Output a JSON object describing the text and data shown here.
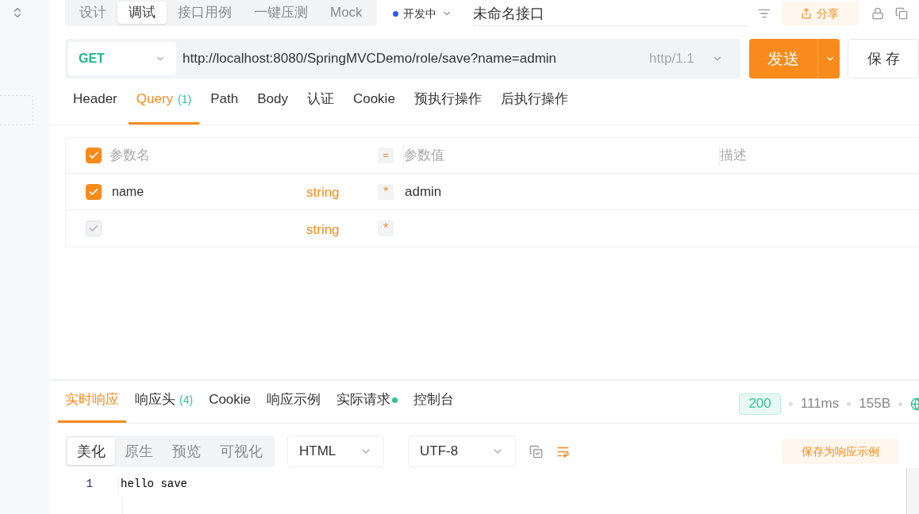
{
  "mode_tabs": [
    {
      "label": "设计",
      "selected": false
    },
    {
      "label": "调试",
      "selected": true
    },
    {
      "label": "接口用例",
      "selected": false
    },
    {
      "label": "一键压测",
      "selected": false
    },
    {
      "label": "Mock",
      "selected": false
    }
  ],
  "status": "开发中",
  "api_name": "未命名接口",
  "share_button": "分享",
  "request": {
    "method": "GET",
    "url": "http://localhost:8080/SpringMVCDemo/role/save?name=admin",
    "protocol": "http/1.1",
    "send_button": "发送",
    "save_button": "保 存"
  },
  "request_tabs": [
    {
      "label": "Header",
      "selected": false
    },
    {
      "label": "Query",
      "count": "(1)",
      "selected": true
    },
    {
      "label": "Path",
      "selected": false
    },
    {
      "label": "Body",
      "selected": false
    },
    {
      "label": "认证",
      "selected": false
    },
    {
      "label": "Cookie",
      "selected": false
    },
    {
      "label": "预执行操作",
      "selected": false
    },
    {
      "label": "后执行操作",
      "selected": false
    }
  ],
  "params": {
    "header": {
      "checked": true,
      "name": "参数名",
      "equals": "=",
      "value": "参数值",
      "description": "描述"
    },
    "rows": [
      {
        "checked": true,
        "disabled": false,
        "name": "name",
        "type": "string",
        "required": "*",
        "value": "admin"
      },
      {
        "checked": true,
        "disabled": true,
        "type": "string",
        "required": "*"
      }
    ]
  },
  "response_tabs": [
    {
      "label": "实时响应",
      "selected": true
    },
    {
      "label": "响应头",
      "count": "(4)",
      "selected": false
    },
    {
      "label": "Cookie",
      "selected": false
    },
    {
      "label": "响应示例",
      "selected": false
    },
    {
      "label": "实际请求",
      "indicator": true,
      "selected": false
    },
    {
      "label": "控制台",
      "selected": false
    }
  ],
  "response_meta": {
    "status_code": "200",
    "time": "111ms",
    "size": "155B"
  },
  "view_tabs": [
    {
      "label": "美化",
      "selected": true
    },
    {
      "label": "原生",
      "selected": false
    },
    {
      "label": "预览",
      "selected": false
    },
    {
      "label": "可视化",
      "selected": false
    }
  ],
  "format": "HTML",
  "encoding": "UTF-8",
  "save_example_button": "保存为响应示例",
  "code_lines": [
    {
      "number": "1",
      "text": "hello save"
    }
  ]
}
